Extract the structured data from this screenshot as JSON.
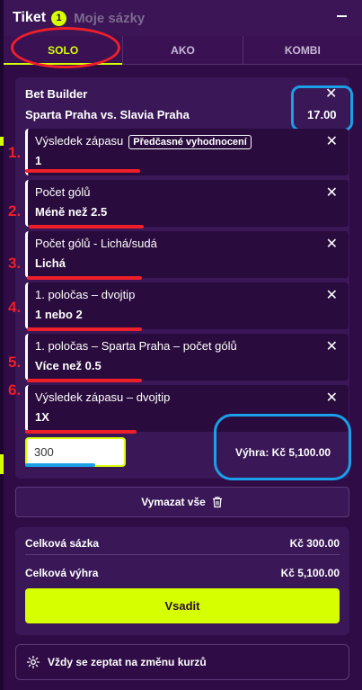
{
  "header": {
    "tab_ticket": "Tiket",
    "ticket_count": "1",
    "tab_my_bets": "Moje sázky"
  },
  "tabs": [
    {
      "label": "SOLO",
      "active": true
    },
    {
      "label": "AKO",
      "active": false
    },
    {
      "label": "KOMBI",
      "active": false
    }
  ],
  "bet_builder": {
    "title": "Bet Builder",
    "match": "Sparta Praha vs. Slavia Praha",
    "odds": "17.00",
    "legs": [
      {
        "num": "1.",
        "market": "Výsledek zápasu",
        "badge": "Předčasné vyhodnocení",
        "selection": "1"
      },
      {
        "num": "2.",
        "market": "Počet gólů",
        "selection": "Méně než 2.5"
      },
      {
        "num": "3.",
        "market": "Počet gólů - Lichá/sudá",
        "selection": "Lichá"
      },
      {
        "num": "4.",
        "market": "1. poločas – dvojtip",
        "selection": "1 nebo 2"
      },
      {
        "num": "5.",
        "market": "1. poločas – Sparta Praha – počet gólů",
        "selection": "Více než 0.5"
      },
      {
        "num": "6.",
        "market": "Výsledek zápasu – dvojtip",
        "selection": "1X"
      }
    ]
  },
  "stake": {
    "value": "300",
    "win_label": "Výhra: Kč 5,100.00"
  },
  "clear_all": "Vymazat vše",
  "summary": {
    "total_stake_label": "Celková sázka",
    "total_stake_value": "Kč 300.00",
    "total_win_label": "Celková výhra",
    "total_win_value": "Kč 5,100.00",
    "place_bet": "Vsadit"
  },
  "odds_change": "Vždy se zeptat na změnu kurzů",
  "colors": {
    "accent": "#d6ff00",
    "background": "#2f0c45",
    "annotation_red": "#ef1f2a",
    "annotation_blue": "#1a9fe8"
  }
}
